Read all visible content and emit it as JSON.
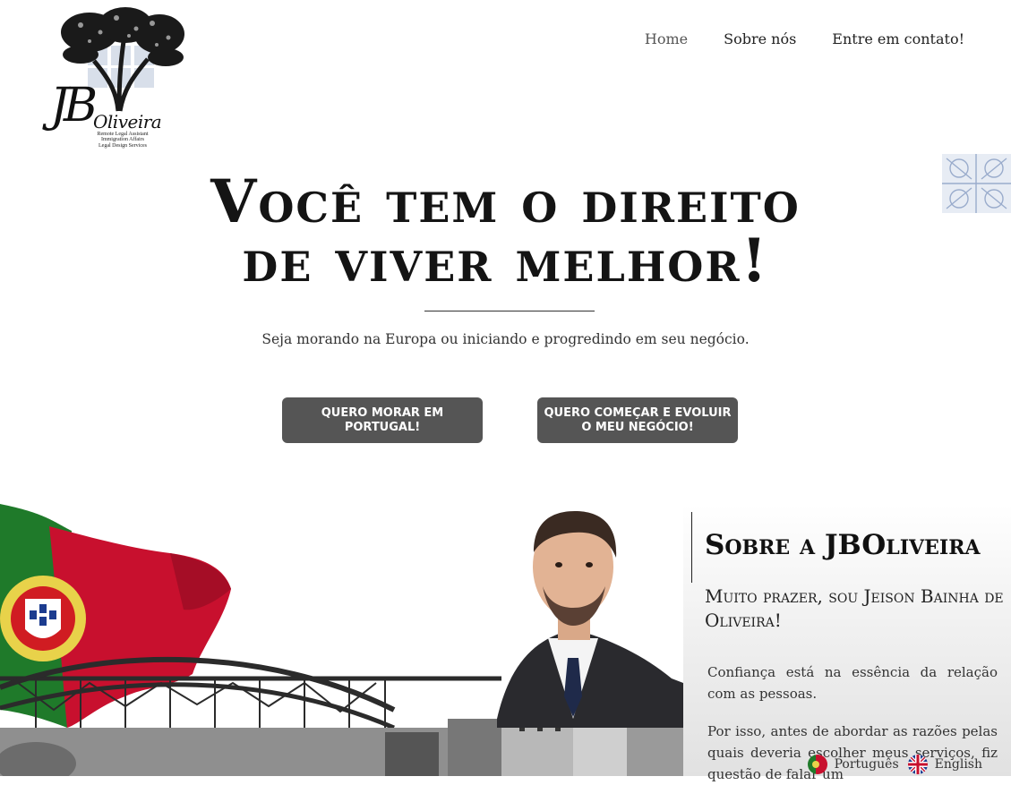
{
  "brand": {
    "logo_text": "JBOliveira",
    "logo_tagline": [
      "Remote Legal Assistant",
      "Immigration Affairs",
      "Legal Design Services"
    ]
  },
  "nav": {
    "items": [
      {
        "label": "Home",
        "active": true
      },
      {
        "label": "Sobre nós",
        "active": false
      },
      {
        "label": "Entre em contato!",
        "active": false
      }
    ]
  },
  "hero": {
    "title_line1": "Você tem o direito",
    "title_line2": "de viver melhor!",
    "subtitle": "Seja morando na Europa ou iniciando e progredindo em seu negócio.",
    "button_primary_line1": "Quero morar em",
    "button_primary_line2": "Portugal!",
    "button_secondary_line1": "Quero começar e evoluir",
    "button_secondary_line2": "o meu negócio!"
  },
  "about": {
    "title": "Sobre a JBOliveira",
    "lead": "Muito prazer, sou Jeison Bainha de Oliveira!",
    "paragraph1": "Confiança está na essência da relação com as pessoas.",
    "paragraph2": "Por isso, antes de abordar as razões pelas quais deveria escolher meus serviços, fiz questão de falar um"
  },
  "language_switcher": {
    "portuguese": "Português",
    "english": "English"
  },
  "colors": {
    "button_bg": "#555555",
    "flag_green": "#1f7a2a",
    "flag_red": "#c8102e",
    "text_dark": "#141414"
  }
}
